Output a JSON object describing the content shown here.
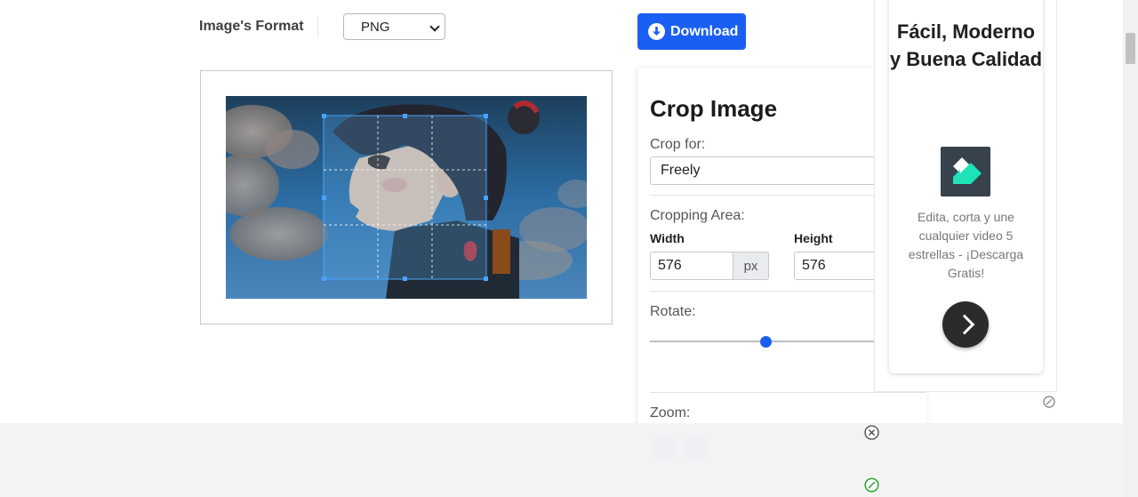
{
  "toolbar": {
    "format_label": "Image's Format",
    "format_selected": "PNG",
    "download_label": "Download"
  },
  "crop": {
    "title": "Crop Image",
    "crop_for_label": "Crop for:",
    "crop_for_value": "Freely",
    "area_label": "Cropping Area:",
    "width_label": "Width",
    "height_label": "Height",
    "width_value": "576",
    "height_value": "576",
    "width_unit": "px",
    "rotate_label": "Rotate:",
    "rotate_fraction": 0.5,
    "zoom_label": "Zoom:"
  },
  "ad": {
    "title": "Fácil, Moderno y Buena Calidad",
    "description": "Edita, corta y une cualquier video 5 estrellas - ¡Descarga Gratis!"
  },
  "colors": {
    "accent": "#1a5ff2",
    "logo_green": "#1ee3b8"
  }
}
